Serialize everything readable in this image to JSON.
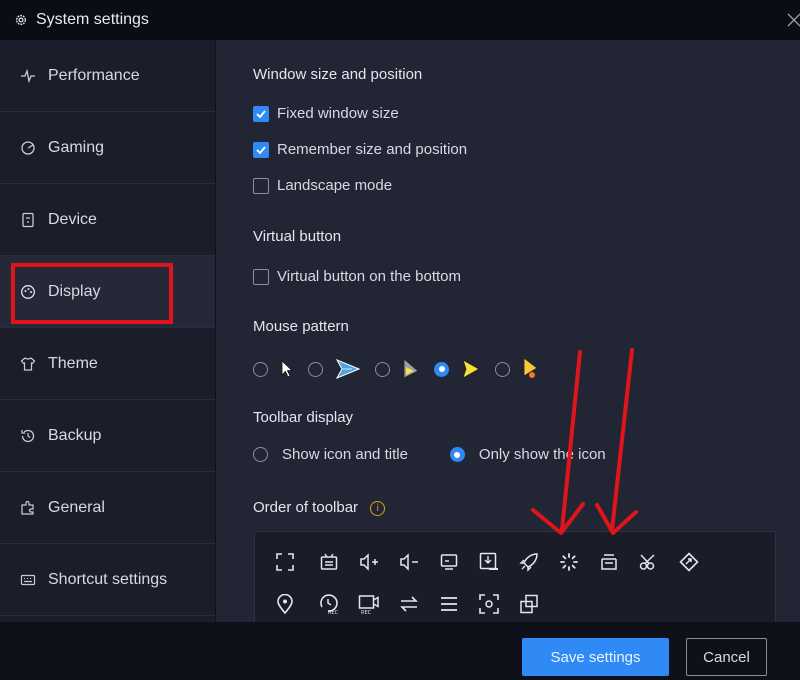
{
  "window": {
    "title": "System settings"
  },
  "sidebar": {
    "items": [
      {
        "label": "Performance",
        "icon": "pulse-icon"
      },
      {
        "label": "Gaming",
        "icon": "gamepad-icon"
      },
      {
        "label": "Device",
        "icon": "phone-icon"
      },
      {
        "label": "Display",
        "icon": "palette-icon",
        "active": true
      },
      {
        "label": "Theme",
        "icon": "shirt-icon"
      },
      {
        "label": "Backup",
        "icon": "history-icon"
      },
      {
        "label": "General",
        "icon": "puzzle-icon"
      },
      {
        "label": "Shortcut settings",
        "icon": "keyboard-icon"
      }
    ]
  },
  "window_section": {
    "title": "Window size and position",
    "fixed_size": {
      "label": "Fixed window size",
      "checked": true
    },
    "remember": {
      "label": "Remember size and position",
      "checked": true
    },
    "landscape": {
      "label": "Landscape mode",
      "checked": false
    }
  },
  "virtual_section": {
    "title": "Virtual button",
    "bottom": {
      "label": "Virtual button on the bottom",
      "checked": false
    }
  },
  "mouse_section": {
    "title": "Mouse pattern",
    "selected_index": 3,
    "options": [
      "white-arrow-cursor-icon",
      "blue-arrow-cursor-icon",
      "yellow-gray-cursor-icon",
      "yellow-arrow-cursor-icon",
      "yellow-orange-cursor-icon"
    ]
  },
  "toolbar_display": {
    "title": "Toolbar display",
    "show_icon_title": "Show icon and title",
    "only_icon": "Only show the icon",
    "selected": "only_icon"
  },
  "toolbar_order": {
    "title": "Order of toolbar",
    "info_icon": "info-icon",
    "icons": [
      "fullscreen-icon",
      "keyboard-mapping-icon",
      "volume-up-icon",
      "volume-down-icon",
      "screen-icon",
      "apk-install-icon",
      "rocket-icon",
      "loading-icon",
      "print-icon",
      "scissors-icon",
      "rotate-icon",
      "location-icon",
      "rec-history-icon",
      "video-rec-icon",
      "swap-icon",
      "menu-icon",
      "screenshot-icon",
      "multi-window-icon"
    ]
  },
  "footer": {
    "save_label": "Save settings",
    "cancel_label": "Cancel"
  },
  "colors": {
    "accent": "#2f8af5",
    "annotation": "#e0141c",
    "background": "#222634",
    "sidebar": "#1b1e2a"
  }
}
